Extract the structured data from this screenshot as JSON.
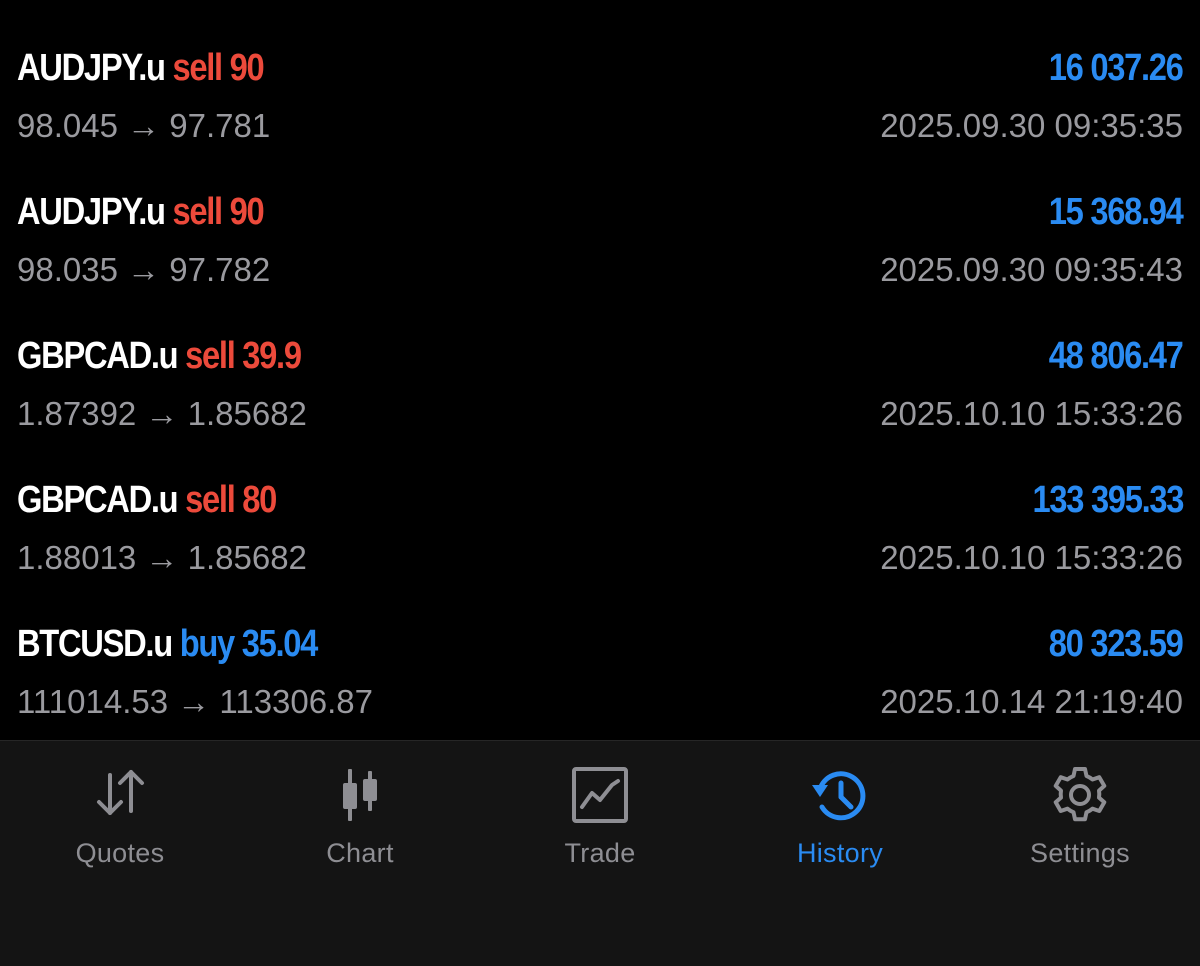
{
  "colors": {
    "background": "#000000",
    "tab_bar_background": "#141414",
    "sell": "#ec4a3b",
    "buy": "#2a8bf2",
    "profit": "#2a8bf2",
    "secondary_text": "#9a9a9f",
    "tab_inactive": "#8e8e93",
    "tab_active": "#2a8bf2"
  },
  "deals": [
    {
      "symbol": "AUDJPY.u",
      "side": "sell",
      "side_text": "sell 90",
      "prices": "98.045 → 97.781",
      "profit": "16 037.26",
      "time": "2025.09.30 09:35:35"
    },
    {
      "symbol": "AUDJPY.u",
      "side": "sell",
      "side_text": "sell 90",
      "prices": "98.035 → 97.782",
      "profit": "15 368.94",
      "time": "2025.09.30 09:35:43"
    },
    {
      "symbol": "GBPCAD.u",
      "side": "sell",
      "side_text": "sell 39.9",
      "prices": "1.87392 → 1.85682",
      "profit": "48 806.47",
      "time": "2025.10.10 15:33:26"
    },
    {
      "symbol": "GBPCAD.u",
      "side": "sell",
      "side_text": "sell 80",
      "prices": "1.88013 → 1.85682",
      "profit": "133 395.33",
      "time": "2025.10.10 15:33:26"
    },
    {
      "symbol": "BTCUSD.u",
      "side": "buy",
      "side_text": "buy 35.04",
      "prices": "111014.53 → 113306.87",
      "profit": "80 323.59",
      "time": "2025.10.14 21:19:40"
    }
  ],
  "tabs": [
    {
      "label": "Quotes",
      "icon": "quotes-arrows-icon",
      "active": false
    },
    {
      "label": "Chart",
      "icon": "candlestick-chart-icon",
      "active": false
    },
    {
      "label": "Trade",
      "icon": "trade-chart-icon",
      "active": false
    },
    {
      "label": "History",
      "icon": "history-clock-icon",
      "active": true
    },
    {
      "label": "Settings",
      "icon": "gear-icon",
      "active": false
    }
  ]
}
